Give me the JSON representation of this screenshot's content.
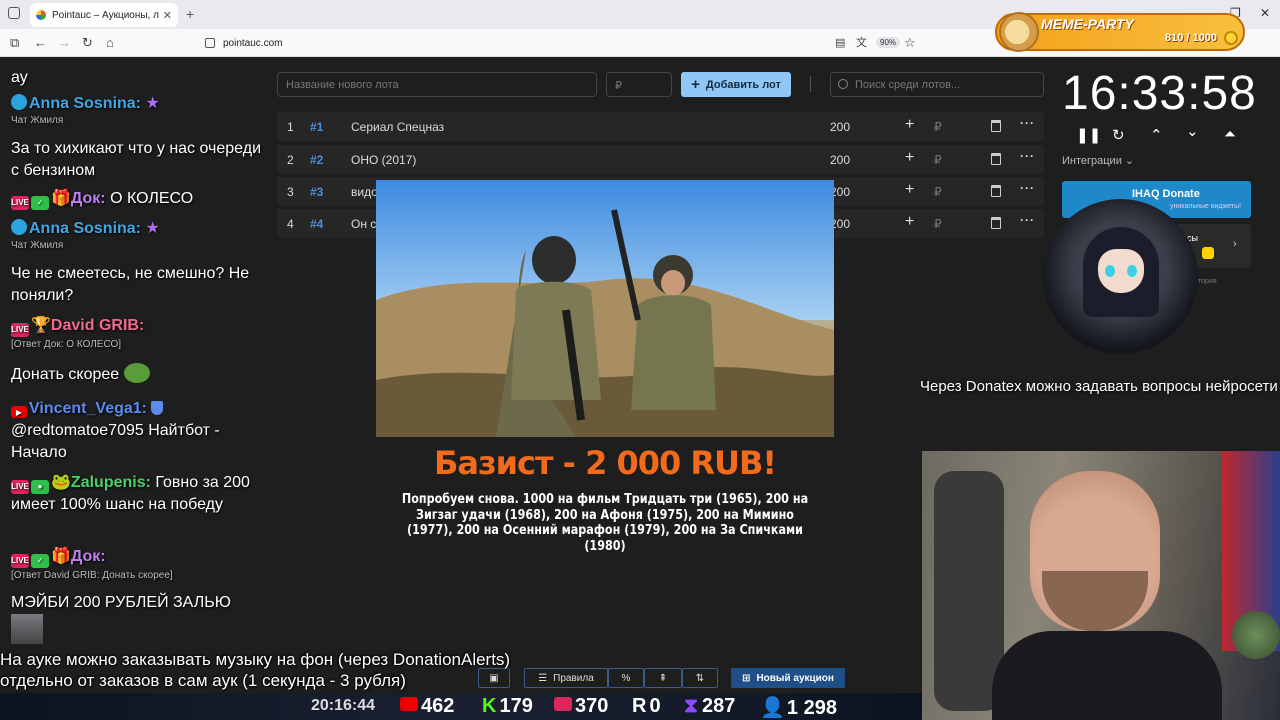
{
  "browser": {
    "tab_title": "Pointauc – Аукционы, лотереи",
    "url": "pointauc.com",
    "zoom": "90%"
  },
  "meme_party": {
    "title": "MEME-PARTY",
    "progress_text": "810 / 1000",
    "progress": 0.81
  },
  "auction": {
    "lot_name_placeholder": "Название нового лота",
    "price_placeholder": "₽",
    "add_button": "Добавить лот",
    "search_placeholder": "Поиск среди лотов...",
    "lots": [
      {
        "num": "1",
        "id": "#1",
        "name": "Сериал Спецназ",
        "amount": "200"
      },
      {
        "num": "2",
        "id": "#2",
        "name": "ОНО (2017)",
        "amount": "200"
      },
      {
        "num": "3",
        "id": "#3",
        "name": "видо",
        "amount": "200"
      },
      {
        "num": "4",
        "id": "#4",
        "name": "Он с",
        "amount": "200"
      }
    ]
  },
  "donation": {
    "title": "Базист - 2 000 RUB!",
    "message": "Попробуем снова. 1000 на фильм Тридцать три (1965),  200 на Зигзаг удачи (1968), 200 на Афоня (1975), 200 на Мимино (1977), 200 на Осенний марафон (1979), 200 на За Спичками (1980)"
  },
  "toolbar": {
    "rules": "Правила",
    "percent": "%",
    "new_auction": "Новый аукцион"
  },
  "ticker": {
    "line1": "На ауке можно заказывать музыку на фон (через DonationAlerts)",
    "line2": "отдельно от заказов в сам аук (1 секунда - 3 рубля)"
  },
  "stats": {
    "clock": "20:16:44",
    "youtube": "462",
    "kick": "179",
    "live": "370",
    "rutube": "0",
    "twitch": "287",
    "viewers": "1 298"
  },
  "timer": {
    "time": "16:33:58"
  },
  "integrations": {
    "label": "Интеграции",
    "ihaq_title": "IHAQ Donate",
    "ihaq_sub": "уникальные виджеты!",
    "card2_title": "исы",
    "history": "тория"
  },
  "donatex_text": "Через Donatex можно задавать вопросы нейросети",
  "chat": [
    {
      "type": "text",
      "text": "ау"
    },
    {
      "type": "nick",
      "nick": "Anna Sosnina:",
      "color": "#3fa7e6",
      "sub": "Чат Жмиля"
    },
    {
      "type": "text",
      "text": "За то хихикают что у нас очереди с бензином"
    },
    {
      "type": "nick",
      "nick": "Док:",
      "color": "#c07ef0",
      "text": "О КОЛЕСО"
    },
    {
      "type": "nick",
      "nick": "Anna Sosnina:",
      "color": "#3fa7e6",
      "sub": "Чат Жмиля"
    },
    {
      "type": "text",
      "text": "Че не смеетесь, не смешно? Не поняли?"
    },
    {
      "type": "nick",
      "nick": "David GRIB:",
      "color": "#f06a8a",
      "sub": "[Ответ Док: О КОЛЕСО]"
    },
    {
      "type": "text",
      "text": "Донать скорее"
    },
    {
      "type": "nick",
      "nick": "Vincent_Vega1:",
      "color": "#5b8bf0",
      "text": "@redtomatoe7095 Найтбот - Начало"
    },
    {
      "type": "nick",
      "nick": "Zalupenis:",
      "color": "#4ad06a",
      "text": "Говно за 200 имеет 100% шанс на победу"
    },
    {
      "type": "nick",
      "nick": "Док:",
      "color": "#c07ef0",
      "sub": "[Ответ David GRIB: Донать скорее]"
    },
    {
      "type": "text",
      "text": "МЭЙБИ 200 РУБЛЕЙ ЗАЛЬЮ"
    }
  ]
}
